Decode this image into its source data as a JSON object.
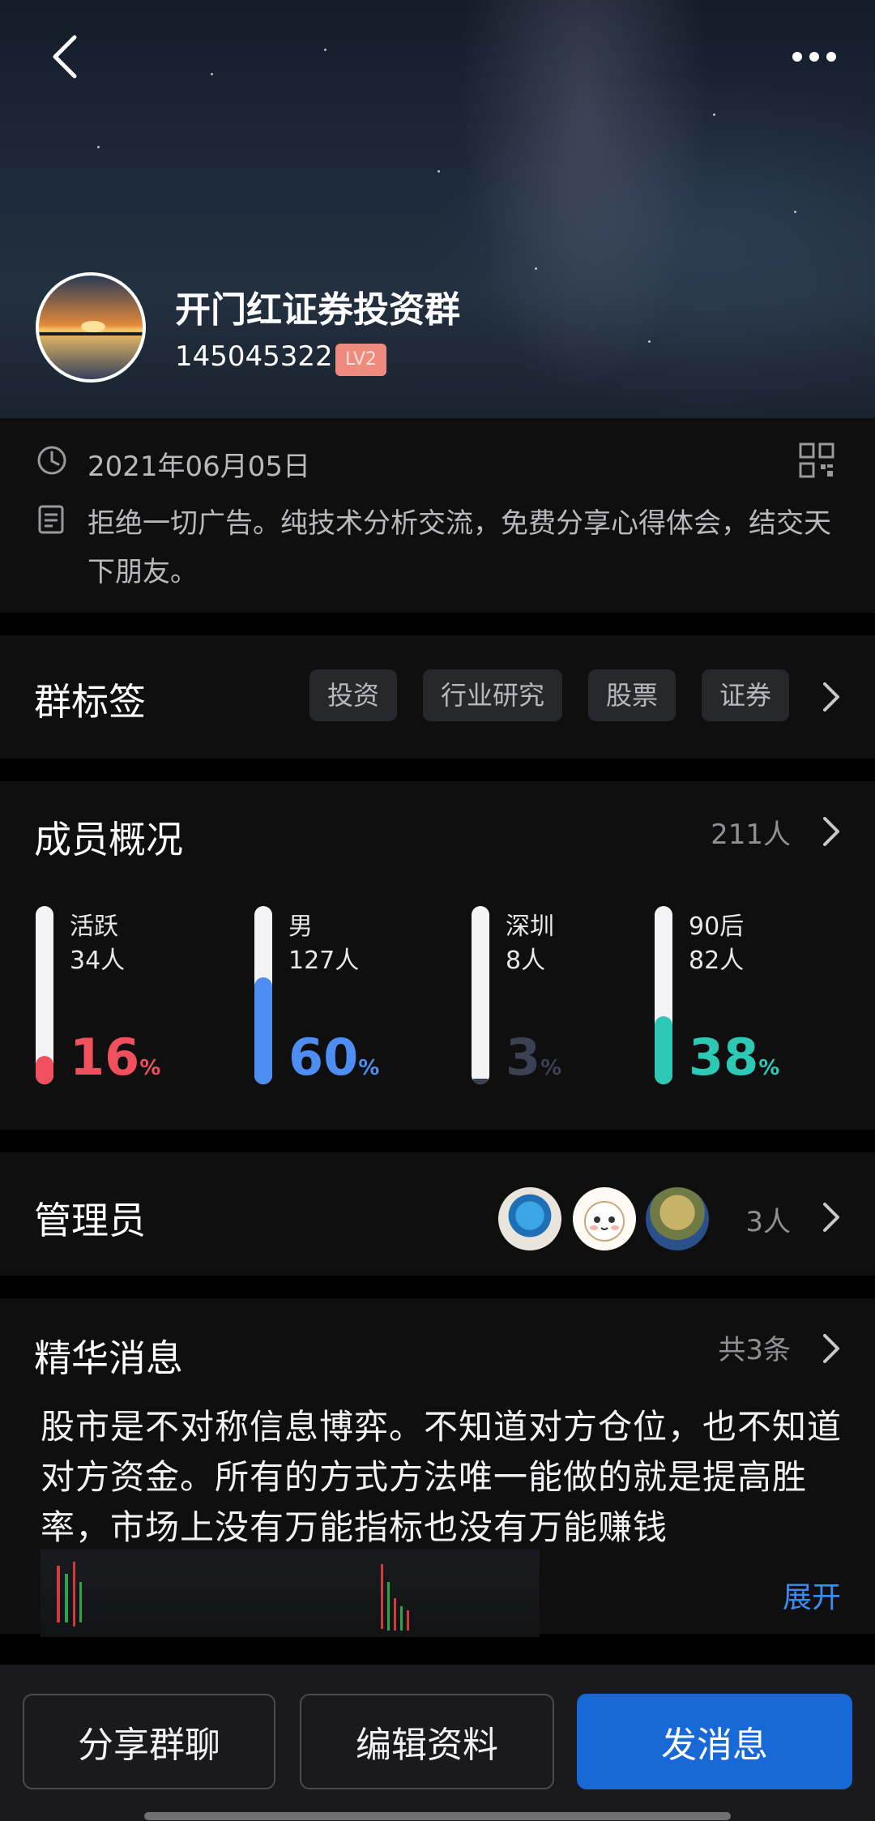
{
  "header": {
    "back_icon": "back-chevron-icon",
    "more_icon": "more-dots-icon"
  },
  "group": {
    "name": "开门红证券投资群",
    "id": "145045322",
    "level": "LV2"
  },
  "info": {
    "date": "2021年06月05日",
    "description": "拒绝一切广告。纯技术分析交流，免费分享心得体会，结交天下朋友。"
  },
  "tags": {
    "title": "群标签",
    "items": [
      "投资",
      "行业研究",
      "股票",
      "证券"
    ]
  },
  "members": {
    "title": "成员概况",
    "total": "211人",
    "stats": [
      {
        "label": "活跃",
        "count": "34人",
        "percent": "16",
        "unit": "%",
        "value": 0.16,
        "color": "#f0505d"
      },
      {
        "label": "男",
        "count": "127人",
        "percent": "60",
        "unit": "%",
        "value": 0.6,
        "color": "#4e8df2"
      },
      {
        "label": "深圳",
        "count": "8人",
        "percent": "3",
        "unit": "%",
        "value": 0.03,
        "color": "#3b4152"
      },
      {
        "label": "90后",
        "count": "82人",
        "percent": "38",
        "unit": "%",
        "value": 0.38,
        "color": "#2ec9b5"
      }
    ]
  },
  "admins": {
    "title": "管理员",
    "count": "3人"
  },
  "essence": {
    "title": "精华消息",
    "count": "共3条",
    "text": "股市是不对称信息博弈。不知道对方仓位，也不知道对方资金。所有的方式方法唯一能做的就是提高胜率，市场上没有万能指标也没有万能赚钱",
    "expand": "展开"
  },
  "actions": {
    "share": "分享群聊",
    "edit": "编辑资料",
    "send": "发消息"
  },
  "colors": {
    "primary": "#1669d6",
    "link": "#3a8df5",
    "badge": "#ef8a7e"
  }
}
